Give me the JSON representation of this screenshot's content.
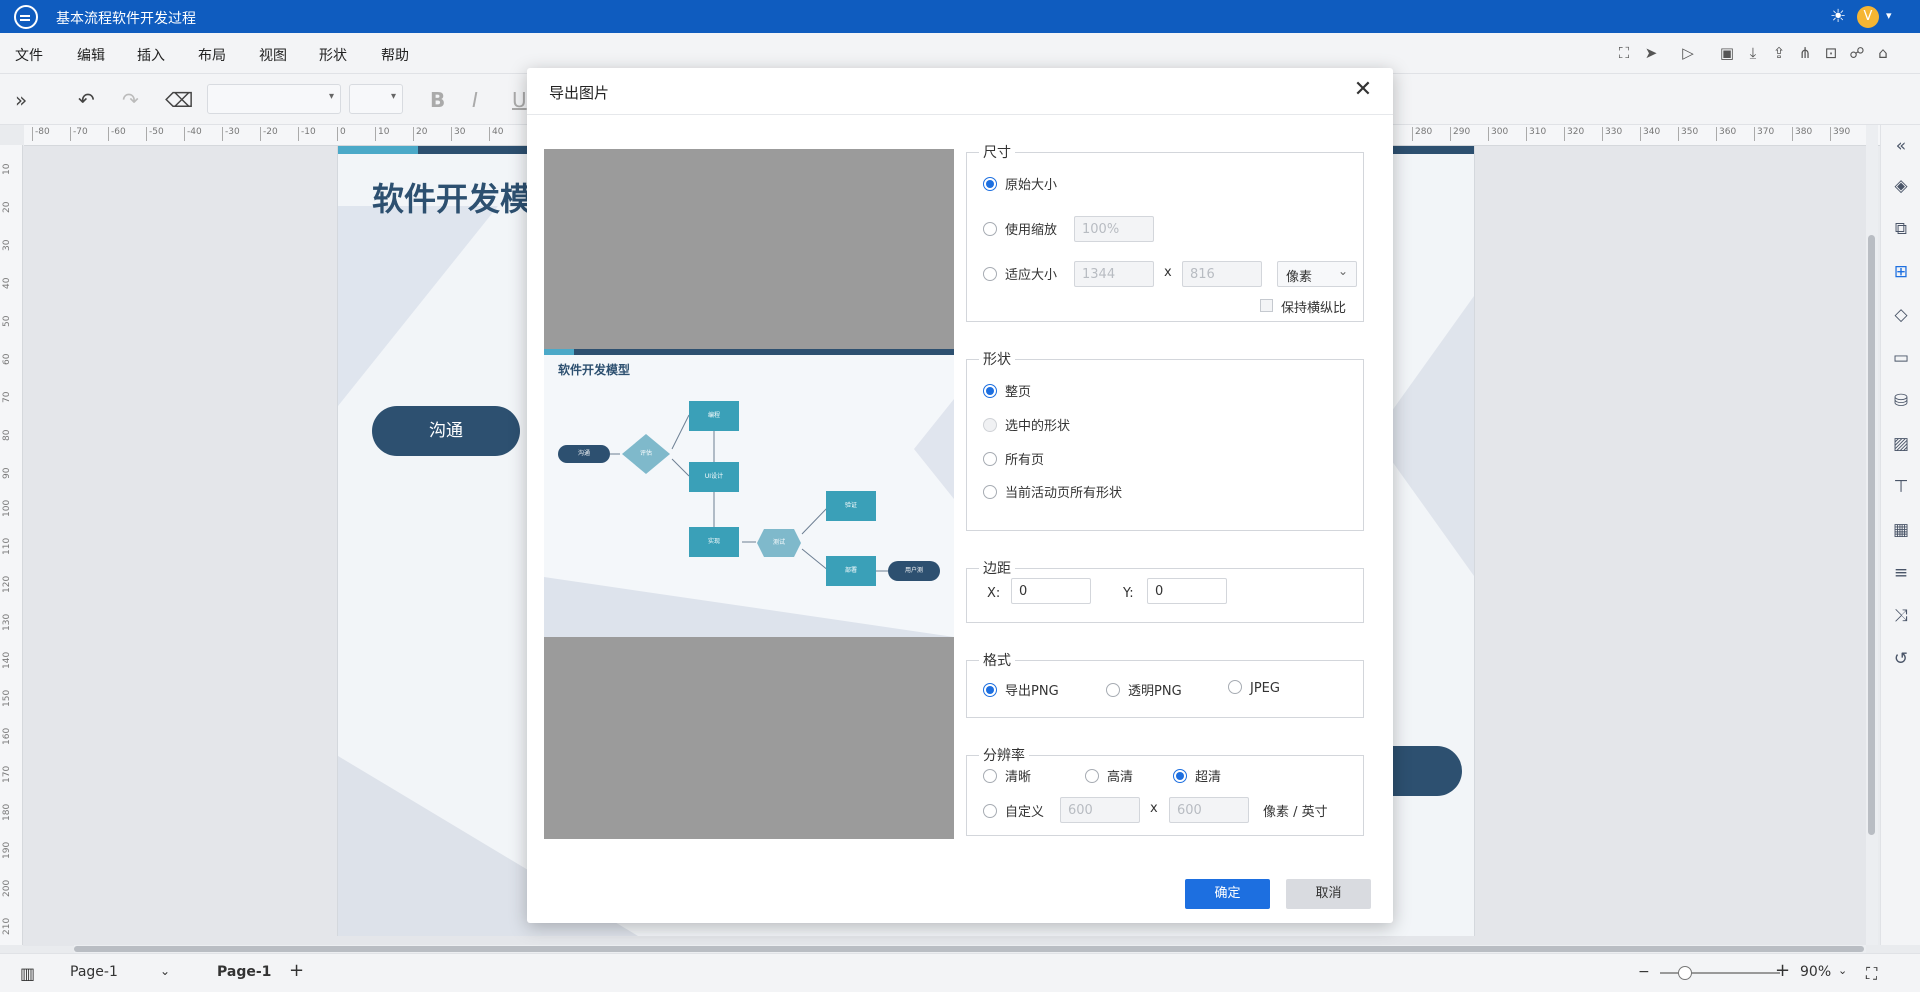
{
  "app": {
    "title": "基本流程软件开发过程"
  },
  "menu": [
    "文件",
    "编辑",
    "插入",
    "布局",
    "视图",
    "形状",
    "帮助"
  ],
  "ruler": {
    "h": [
      "-80",
      "-70",
      "-60",
      "-50",
      "-40",
      "-30",
      "-20",
      "-10",
      "0",
      "10",
      "20",
      "30",
      "40",
      "280",
      "290",
      "300",
      "310",
      "320",
      "330",
      "340",
      "350",
      "360",
      "370",
      "380",
      "390"
    ],
    "v": [
      "10",
      "20",
      "30",
      "40",
      "50",
      "60",
      "70",
      "80",
      "90",
      "100",
      "110",
      "120",
      "130",
      "140",
      "150",
      "160",
      "170",
      "180",
      "190",
      "200",
      "210"
    ]
  },
  "canvas": {
    "doc_title": "软件开发模",
    "pill_label": "沟通"
  },
  "dialog": {
    "title": "导出图片",
    "close": "✕",
    "preview": {
      "title": "软件开发模型",
      "nodes": [
        "沟通",
        "评估",
        "编程",
        "UI设计",
        "实现",
        "测试",
        "验证",
        "部署",
        "用户测"
      ]
    },
    "size": {
      "legend": "尺寸",
      "original": "原始大小",
      "use_scale": "使用缩放",
      "scale_value": "100%",
      "fit_size": "适应大小",
      "width": "1344",
      "times": "x",
      "height": "816",
      "unit": "像素",
      "keep_ratio": "保持横纵比"
    },
    "shape": {
      "legend": "形状",
      "options": [
        "整页",
        "选中的形状",
        "所有页",
        "当前活动页所有形状"
      ]
    },
    "margin": {
      "legend": "边距",
      "x_label": "X:",
      "x_value": "0",
      "y_label": "Y:",
      "y_value": "0"
    },
    "format": {
      "legend": "格式",
      "options": [
        "导出PNG",
        "透明PNG",
        "JPEG"
      ]
    },
    "resolution": {
      "legend": "分辨率",
      "options": [
        "清晰",
        "高清",
        "超清"
      ],
      "custom": "自定义",
      "custom_w": "600",
      "times": "x",
      "custom_h": "600",
      "unit": "像素 / 英寸"
    },
    "ok": "确定",
    "cancel": "取消"
  },
  "status": {
    "page_selector": "Page-1",
    "page_tab": "Page-1",
    "add": "+",
    "zoom": "90%"
  }
}
